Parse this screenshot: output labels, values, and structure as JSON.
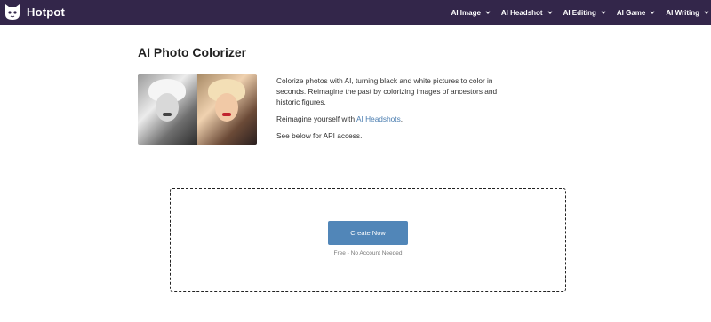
{
  "header": {
    "brand": "Hotpot",
    "nav": [
      {
        "label": "AI Image"
      },
      {
        "label": "AI Headshot"
      },
      {
        "label": "AI Editing"
      },
      {
        "label": "AI Game"
      },
      {
        "label": "AI Writing"
      }
    ]
  },
  "main": {
    "title": "AI Photo Colorizer",
    "description_1": "Colorize photos with AI, turning black and white pictures to color in seconds. Reimagine the past by colorizing images of ancestors and historic figures.",
    "description_2_prefix": "Reimagine yourself with ",
    "description_2_link": "AI Headshots",
    "description_2_suffix": ".",
    "description_3": "See below for API access."
  },
  "upload": {
    "button_label": "Create Now",
    "note": "Free - No Account Needed"
  },
  "colors": {
    "topbar": "#33264a",
    "button": "#5186b8",
    "link": "#4a7db0"
  },
  "icons": {
    "logo": "hotpot-logo-icon",
    "chevron": "chevron-down-icon"
  }
}
